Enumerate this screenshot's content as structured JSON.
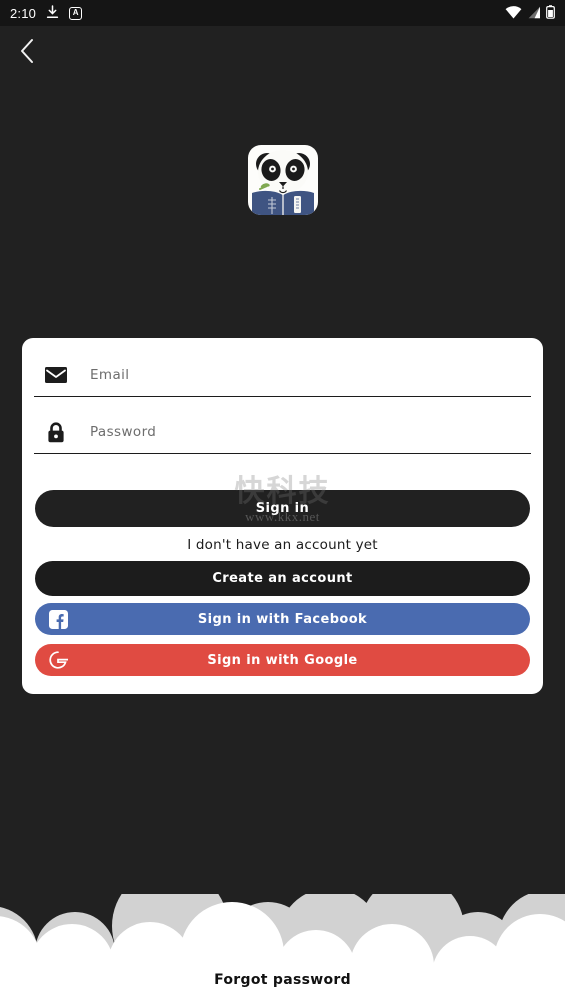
{
  "status_bar": {
    "time": "2:10",
    "icons": [
      "download-icon",
      "app-badge-a-icon",
      "wifi-icon",
      "cellular-signal-icon",
      "battery-icon"
    ],
    "badge_letter": "A",
    "background": "#151515"
  },
  "nav": {
    "back_icon": "chevron-left-icon"
  },
  "logo": {
    "name": "panda-reading-book-logo",
    "background": "#fdfdfb",
    "book_color": "#3f5482",
    "panda_color": "#1b1b1b"
  },
  "card": {
    "background": "#ffffff",
    "fields": [
      {
        "name": "email",
        "icon": "envelope-icon",
        "placeholder": "Email",
        "value": ""
      },
      {
        "name": "password",
        "icon": "lock-icon",
        "placeholder": "Password",
        "value": ""
      }
    ],
    "sign_in_label": "Sign in",
    "no_account_text": "I don't have an account yet",
    "create_account_label": "Create an account",
    "facebook_label": "Sign in with Facebook",
    "google_label": "Sign in with Google",
    "colors": {
      "primary": "#212121",
      "facebook": "#4a6bb0",
      "google": "#e04b42"
    }
  },
  "watermark": {
    "mark": "快科技",
    "url": "www.kkx.net"
  },
  "footer": {
    "forgot_password_label": "Forgot password",
    "cloud_back_color": "#d2d2d2",
    "cloud_front_color": "#ffffff"
  },
  "page": {
    "background": "#212121"
  }
}
